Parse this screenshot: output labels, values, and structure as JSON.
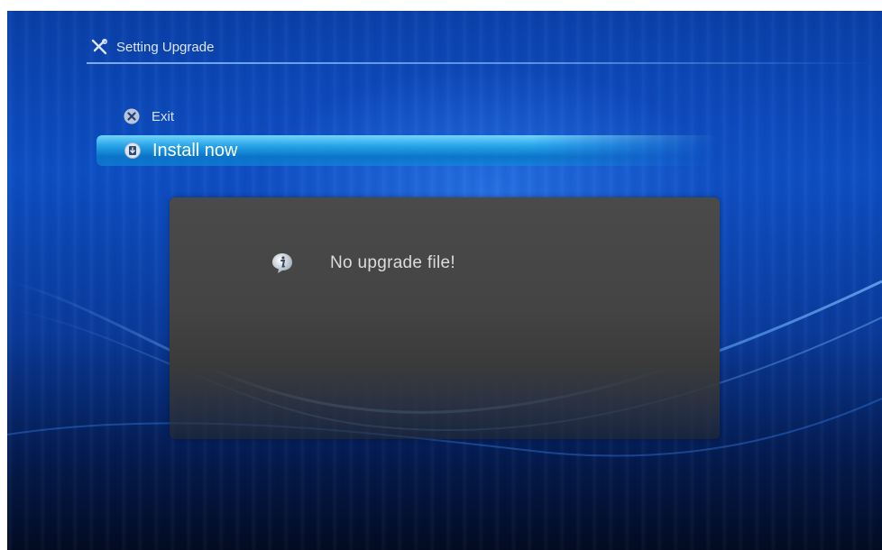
{
  "header": {
    "title": "Setting Upgrade",
    "icon": "tools-icon"
  },
  "menu": {
    "items": [
      {
        "label": "Exit",
        "icon": "close-circle-icon",
        "selected": false
      },
      {
        "label": "Install now",
        "icon": "install-icon",
        "selected": true
      }
    ]
  },
  "dialog": {
    "message": "No upgrade file!",
    "icon": "info-icon"
  },
  "colors": {
    "background": "#0d4fc4",
    "highlight": "#28aaeb",
    "dialog": "#444444"
  }
}
